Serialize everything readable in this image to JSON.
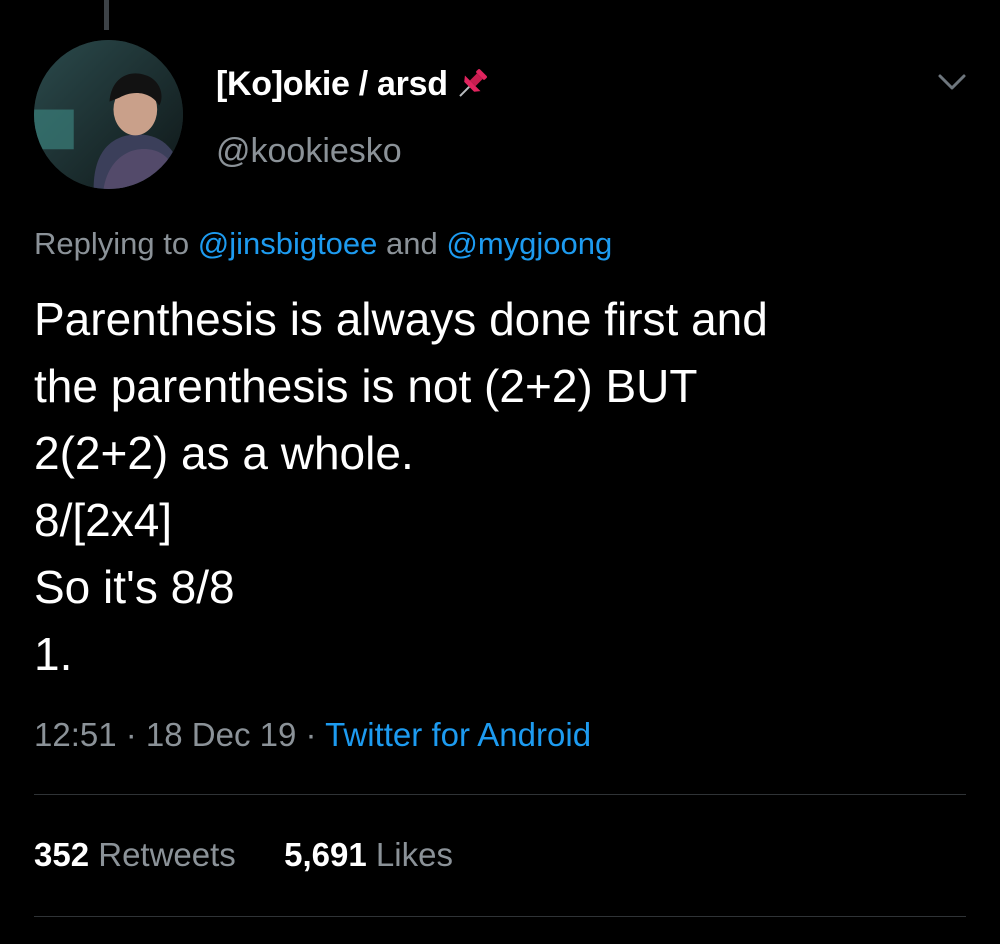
{
  "author": {
    "display_name": "[Ko]okie / arsd",
    "handle": "@kookiesko",
    "avatar": "profile-photo",
    "name_icon": "pushpin-icon"
  },
  "reply": {
    "prefix": "Replying to ",
    "mention1": "@jinsbigtoee",
    "joiner": " and ",
    "mention2": "@mygjoong"
  },
  "tweet": {
    "lines": [
      "Parenthesis is always done first and",
      "the parenthesis is not (2+2) BUT",
      "2(2+2) as a whole.",
      "8/[2x4]",
      "So it's 8/8",
      "1."
    ]
  },
  "meta": {
    "time": "12:51",
    "sep1": " · ",
    "date": "18 Dec 19",
    "sep2": " · ",
    "source": "Twitter for Android"
  },
  "stats": {
    "retweets_count": "352",
    "retweets_label": "Retweets",
    "likes_count": "5,691",
    "likes_label": "Likes"
  },
  "colors": {
    "background": "#000000",
    "link": "#1d9bf0",
    "secondary_text": "#8b9298",
    "pin": "#e0245e"
  },
  "icons": {
    "menu": "chevron-down-icon"
  }
}
